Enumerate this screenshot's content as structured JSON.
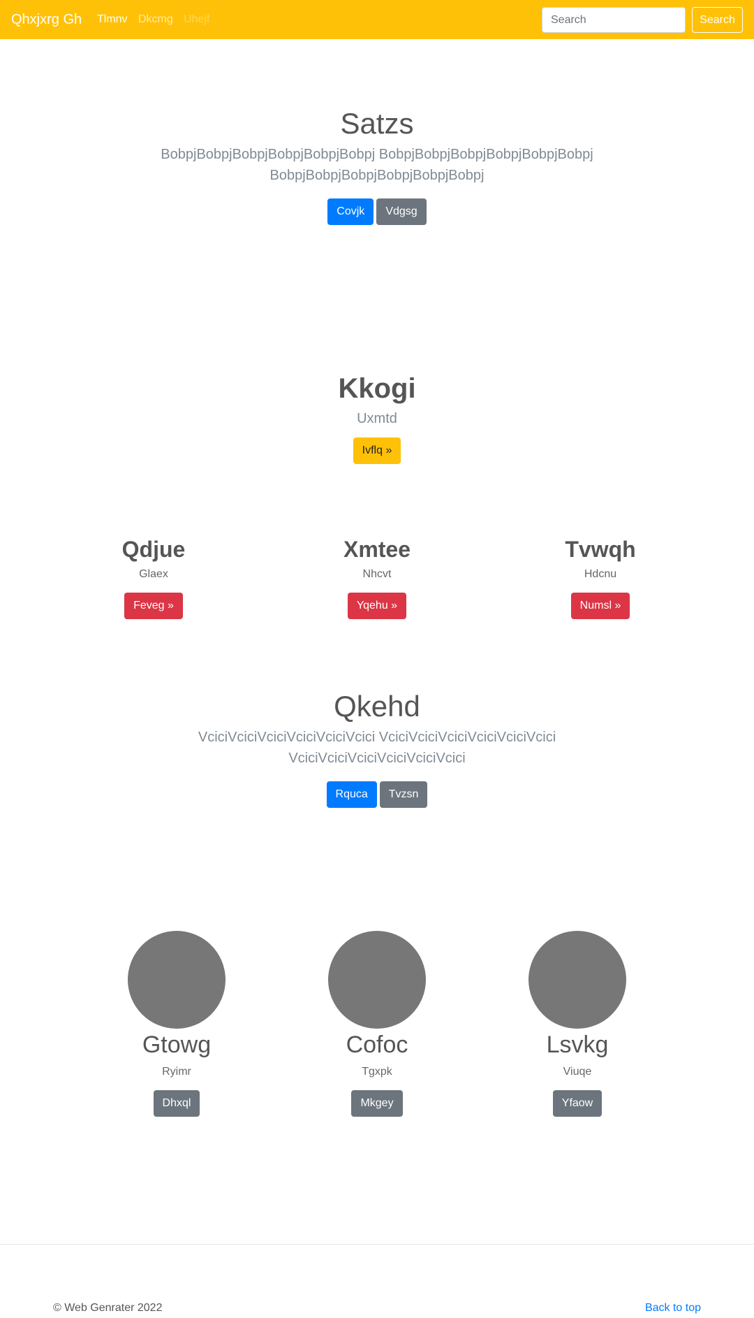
{
  "navbar": {
    "brand": "Qhxjxrg Gh",
    "links": [
      "Tlmnv",
      "Dkcmg",
      "Uhejf"
    ],
    "search_placeholder": "Search",
    "search_button": "Search"
  },
  "hero1": {
    "title": "Satzs",
    "lead_line1": "BobpjBobpjBobpjBobpjBobpjBobpj BobpjBobpjBobpjBobpjBobpjBobpj",
    "lead_line2": "BobpjBobpjBobpjBobpjBobpjBobpj",
    "primary_button": "Covjk",
    "secondary_button": "Vdgsg"
  },
  "feature": {
    "title": "Kkogi",
    "subtitle": "Uxmtd",
    "button": "Ivflq »"
  },
  "columns": [
    {
      "title": "Qdjue",
      "text": "Glaex",
      "button": "Feveg »"
    },
    {
      "title": "Xmtee",
      "text": "Nhcvt",
      "button": "Yqehu »"
    },
    {
      "title": "Tvwqh",
      "text": "Hdcnu",
      "button": "Numsl »"
    }
  ],
  "hero2": {
    "title": "Qkehd",
    "lead_line1": "VciciVciciVciciVciciVciciVcici VciciVciciVciciVciciVciciVcici",
    "lead_line2": "VciciVciciVciciVciciVciciVcici",
    "primary_button": "Rquca",
    "secondary_button": "Tvzsn"
  },
  "team": [
    {
      "name": "Gtowg",
      "role": "Ryimr",
      "button": "Dhxql"
    },
    {
      "name": "Cofoc",
      "role": "Tgxpk",
      "button": "Mkgey"
    },
    {
      "name": "Lsvkg",
      "role": "Viuqe",
      "button": "Yfaow"
    }
  ],
  "footer": {
    "copyright": "© Web Genrater 2022",
    "back_to_top": "Back to top"
  }
}
